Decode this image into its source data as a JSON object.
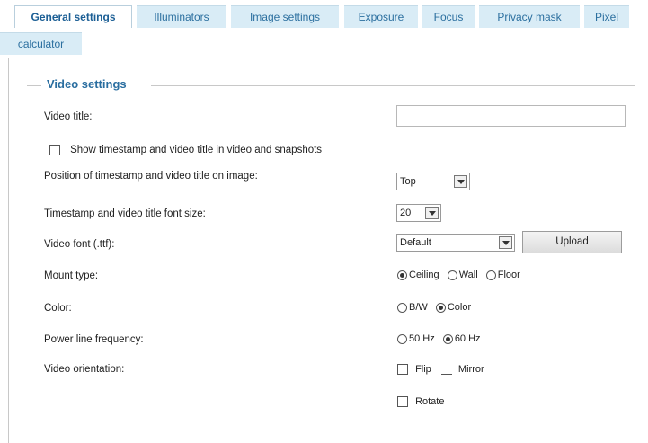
{
  "tabs": [
    {
      "label": "General settings",
      "active": true
    },
    {
      "label": "Illuminators"
    },
    {
      "label": "Image settings"
    },
    {
      "label": "Exposure"
    },
    {
      "label": "Focus"
    },
    {
      "label": "Privacy mask"
    },
    {
      "label": "Pixel"
    },
    {
      "label": "calculator"
    }
  ],
  "section": {
    "legend": "Video settings"
  },
  "fields": {
    "video_title": {
      "label": "Video title:",
      "value": ""
    },
    "show_timestamp": {
      "label": "Show timestamp and video title in video and snapshots",
      "checked": false
    },
    "position": {
      "label": "Position of timestamp and video title on image:",
      "value": "Top"
    },
    "font_size": {
      "label": "Timestamp and video title font size:",
      "value": "20"
    },
    "video_font": {
      "label": "Video font (.ttf):",
      "value": "Default",
      "button": "Upload"
    },
    "mount_type": {
      "label": "Mount type:",
      "options": [
        "Ceiling",
        "Wall",
        "Floor"
      ],
      "selected": "Ceiling"
    },
    "color": {
      "label": "Color:",
      "options": [
        "B/W",
        "Color"
      ],
      "selected": "Color"
    },
    "power_line": {
      "label": "Power line frequency:",
      "options": [
        "50 Hz",
        "60 Hz"
      ],
      "selected": "60 Hz"
    },
    "orientation": {
      "label": "Video orientation:",
      "flip": "Flip",
      "mirror": "Mirror",
      "rotate": "Rotate"
    }
  }
}
